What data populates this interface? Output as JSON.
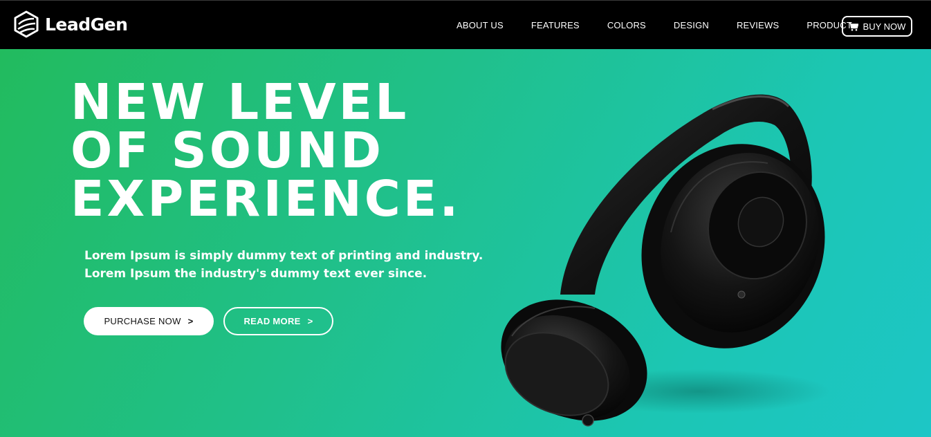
{
  "brand": {
    "name": "LeadGen",
    "icon": "hexagon-logo-icon"
  },
  "nav": {
    "items": [
      {
        "label": "ABOUT US"
      },
      {
        "label": "FEATURES"
      },
      {
        "label": "COLORS"
      },
      {
        "label": "DESIGN"
      },
      {
        "label": "REVIEWS"
      },
      {
        "label": "PRODUCT"
      }
    ],
    "cta": {
      "label": "BUY NOW",
      "icon": "cart-icon"
    }
  },
  "hero": {
    "headline": [
      "NEW LEVEL",
      "OF SOUND",
      "EXPERIENCE."
    ],
    "lead": [
      "Lorem Ipsum is simply dummy text of printing and industry.",
      "Lorem Ipsum the industry's dummy text ever since."
    ],
    "buttons": {
      "primary": {
        "label": "PURCHASE NOW",
        "chevron": ">"
      },
      "secondary": {
        "label": "READ MORE",
        "chevron": ">"
      }
    },
    "image": "headphones-image"
  },
  "colors": {
    "topbar": "#000000",
    "gradient_start": "#22bb5e",
    "gradient_end": "#1dc6c6",
    "text": "#ffffff"
  }
}
